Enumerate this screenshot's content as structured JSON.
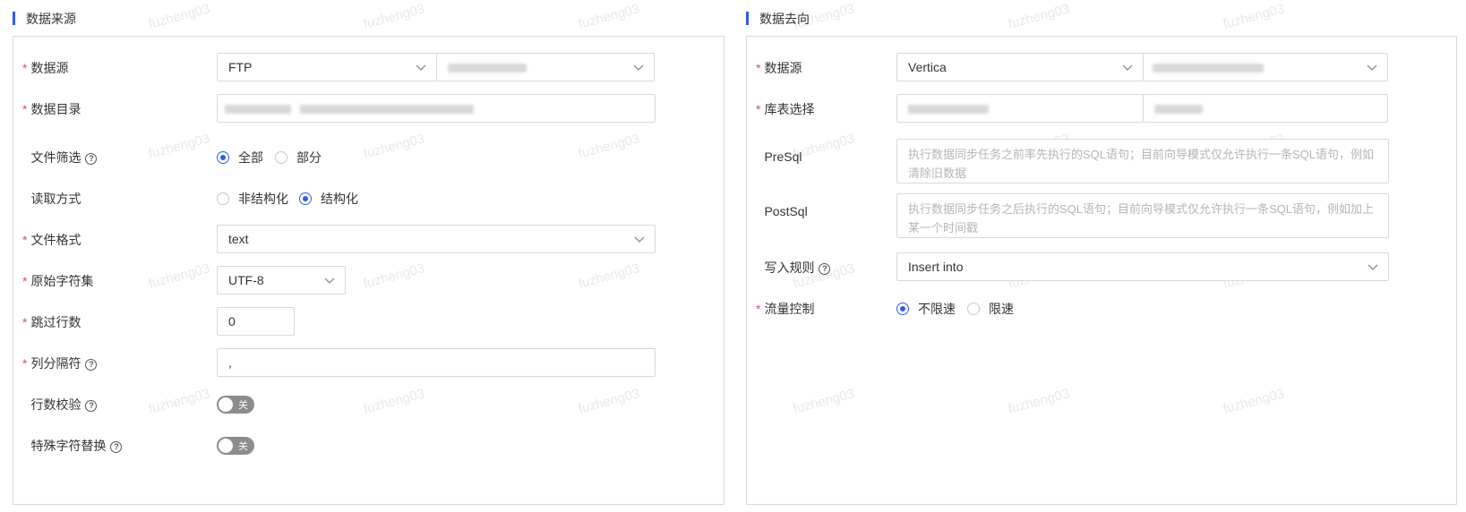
{
  "source": {
    "title": "数据来源",
    "datasource": {
      "label": "数据源",
      "type_value": "FTP"
    },
    "directory": {
      "label": "数据目录"
    },
    "file_filter": {
      "label": "文件筛选",
      "option_all": "全部",
      "option_partial": "部分",
      "selected": "全部"
    },
    "read_mode": {
      "label": "读取方式",
      "option_unstructured": "非结构化",
      "option_structured": "结构化",
      "selected": "结构化"
    },
    "file_format": {
      "label": "文件格式",
      "value": "text"
    },
    "charset": {
      "label": "原始字符集",
      "value": "UTF-8"
    },
    "skip_rows": {
      "label": "跳过行数",
      "value": "0"
    },
    "column_separator": {
      "label": "列分隔符",
      "value": ","
    },
    "row_check": {
      "label": "行数校验",
      "switch_text": "关",
      "on": false
    },
    "special_char": {
      "label": "特殊字符替换",
      "switch_text": "关",
      "on": false
    }
  },
  "target": {
    "title": "数据去向",
    "datasource": {
      "label": "数据源",
      "type_value": "Vertica"
    },
    "table_select": {
      "label": "库表选择"
    },
    "presql": {
      "label": "PreSql",
      "placeholder": "执行数据同步任务之前率先执行的SQL语句；目前向导模式仅允许执行一条SQL语句，例如清除旧数据"
    },
    "postsql": {
      "label": "PostSql",
      "placeholder": "执行数据同步任务之后执行的SQL语句；目前向导模式仅允许执行一条SQL语句，例如加上某一个时间戳"
    },
    "write_rule": {
      "label": "写入规则",
      "value": "Insert into"
    },
    "flow_control": {
      "label": "流量控制",
      "option_unlimited": "不限速",
      "option_limited": "限速",
      "selected": "不限速"
    }
  },
  "watermark": {
    "text": "fuzheng03"
  },
  "colors": {
    "accent": "#2f5bea",
    "required": "#e34d59",
    "border": "#d9d9d9",
    "switch_off": "#8c8c8c"
  }
}
